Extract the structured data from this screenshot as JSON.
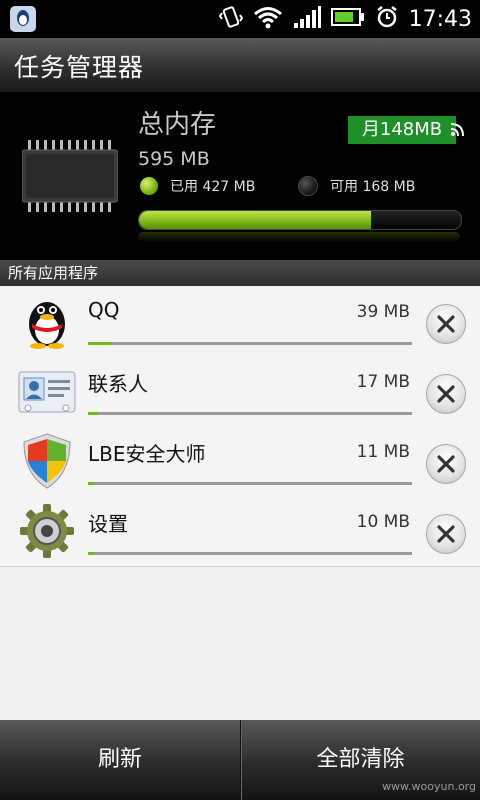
{
  "status_bar": {
    "time": "17:43"
  },
  "header": {
    "title": "任务管理器"
  },
  "memory": {
    "label": "总内存",
    "total": "595 MB",
    "used_label": "已用 427 MB",
    "available_label": "可用 168 MB",
    "used_fraction": 0.72,
    "monthly_badge": "月148MB",
    "colors": {
      "used": "#7fb90e",
      "badge": "#1f8f2a"
    }
  },
  "section_title": "所有应用程序",
  "apps": [
    {
      "name": "QQ",
      "size": "39 MB",
      "usage_fraction": 0.07,
      "icon": "qq-penguin-icon"
    },
    {
      "name": "联系人",
      "size": "17 MB",
      "usage_fraction": 0.03,
      "icon": "contacts-card-icon"
    },
    {
      "name": "LBE安全大师",
      "size": "11 MB",
      "usage_fraction": 0.02,
      "icon": "shield-icon"
    },
    {
      "name": "设置",
      "size": "10 MB",
      "usage_fraction": 0.02,
      "icon": "gear-icon"
    }
  ],
  "footer": {
    "refresh_label": "刷新",
    "clear_all_label": "全部清除"
  },
  "watermark": "www.wooyun.org"
}
